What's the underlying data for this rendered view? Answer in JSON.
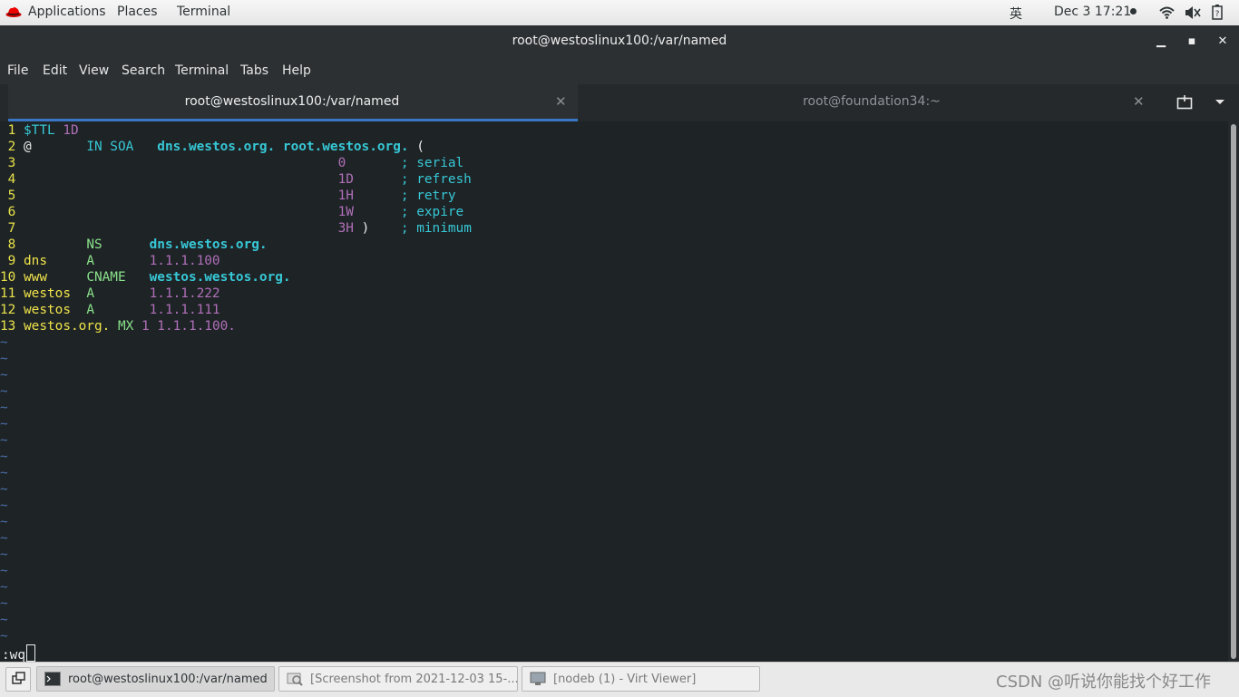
{
  "topbar": {
    "applications": "Applications",
    "places": "Places",
    "terminal": "Terminal",
    "ime": "英",
    "clock": "Dec 3  17:21"
  },
  "window": {
    "title": "root@westoslinux100:/var/named"
  },
  "menu": [
    "File",
    "Edit",
    "View",
    "Search",
    "Terminal",
    "Tabs",
    "Help"
  ],
  "tabs": [
    {
      "label": "root@westoslinux100:/var/named",
      "active": true
    },
    {
      "label": "root@foundation34:~",
      "active": false
    }
  ],
  "editor": {
    "lines": [
      {
        "n": " 1",
        "parts": [
          [
            "c-cyan",
            "$TTL "
          ],
          [
            "c-purple",
            "1D"
          ]
        ]
      },
      {
        "n": " 2",
        "parts": [
          [
            "c-white",
            "@       "
          ],
          [
            "c-cyan",
            "IN SOA   "
          ],
          [
            "c-cyanb",
            "dns.westos.org. root.westos.org. "
          ],
          [
            "c-white",
            "("
          ]
        ]
      },
      {
        "n": " 3",
        "parts": [
          [
            "c-white",
            "                                        "
          ],
          [
            "c-purple",
            "0       "
          ],
          [
            "c-cyan",
            "; serial"
          ]
        ]
      },
      {
        "n": " 4",
        "parts": [
          [
            "c-white",
            "                                        "
          ],
          [
            "c-purple",
            "1D      "
          ],
          [
            "c-cyan",
            "; refresh"
          ]
        ]
      },
      {
        "n": " 5",
        "parts": [
          [
            "c-white",
            "                                        "
          ],
          [
            "c-purple",
            "1H      "
          ],
          [
            "c-cyan",
            "; retry"
          ]
        ]
      },
      {
        "n": " 6",
        "parts": [
          [
            "c-white",
            "                                        "
          ],
          [
            "c-purple",
            "1W      "
          ],
          [
            "c-cyan",
            "; expire"
          ]
        ]
      },
      {
        "n": " 7",
        "parts": [
          [
            "c-white",
            "                                        "
          ],
          [
            "c-purple",
            "3H "
          ],
          [
            "c-white",
            ")    "
          ],
          [
            "c-cyan",
            "; minimum"
          ]
        ]
      },
      {
        "n": " 8",
        "parts": [
          [
            "c-white",
            "        "
          ],
          [
            "c-green",
            "NS      "
          ],
          [
            "c-cyanb",
            "dns.westos.org."
          ]
        ]
      },
      {
        "n": " 9",
        "parts": [
          [
            "c-yellow",
            "dns     "
          ],
          [
            "c-green",
            "A       "
          ],
          [
            "c-purple",
            "1.1.1.100"
          ]
        ]
      },
      {
        "n": "10",
        "parts": [
          [
            "c-yellow",
            "www     "
          ],
          [
            "c-green",
            "CNAME   "
          ],
          [
            "c-cyanb",
            "westos.westos.org."
          ]
        ]
      },
      {
        "n": "11",
        "parts": [
          [
            "c-yellow",
            "westos  "
          ],
          [
            "c-green",
            "A       "
          ],
          [
            "c-purple",
            "1.1.1.222"
          ]
        ]
      },
      {
        "n": "12",
        "parts": [
          [
            "c-yellow",
            "westos  "
          ],
          [
            "c-green",
            "A       "
          ],
          [
            "c-purple",
            "1.1.1.111"
          ]
        ]
      },
      {
        "n": "13",
        "parts": [
          [
            "c-yellow",
            "westos.org. "
          ],
          [
            "c-green",
            "MX "
          ],
          [
            "c-purple",
            "1 1.1.1.100."
          ]
        ]
      }
    ],
    "tilde_count": 19,
    "tilde_char": "~",
    "command": ":wq"
  },
  "taskbar": {
    "items": [
      {
        "label": "root@westoslinux100:/var/named",
        "icon": "terminal-icon",
        "active": true
      },
      {
        "label": "[Screenshot from 2021-12-03 15-...",
        "icon": "screenshot-icon",
        "active": false
      },
      {
        "label": "[nodeb (1) - Virt Viewer]",
        "icon": "monitor-icon",
        "active": false
      }
    ],
    "watermark": "CSDN @听说你能找个好工作"
  },
  "colors": {
    "terminal_bg": "#1e2326",
    "tab_accent": "#3a76c4",
    "line_number": "#e8e24a",
    "keyword_cyan": "#37c8d6",
    "number_purple": "#b070b8",
    "type_green": "#8ae28a",
    "tilde_blue": "#4b6fa8"
  }
}
